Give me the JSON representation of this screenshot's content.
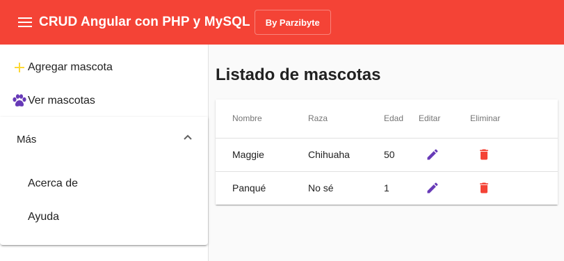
{
  "toolbar": {
    "title": "CRUD Angular con PHP y MySQL",
    "by_label": "By Parzibyte",
    "menu_icon": "menu-icon",
    "color": "#f44336"
  },
  "sidenav": {
    "items": [
      {
        "label": "Agregar mascota",
        "icon": "plus-icon",
        "icon_color": "#fdd835"
      },
      {
        "label": "Ver mascotas",
        "icon": "paw-icon",
        "icon_color": "#673ab7"
      }
    ],
    "panel": {
      "label": "Más",
      "expanded": true,
      "items": [
        {
          "label": "Acerca de"
        },
        {
          "label": "Ayuda"
        }
      ]
    }
  },
  "main": {
    "title": "Listado de mascotas",
    "table": {
      "headers": [
        "Nombre",
        "Raza",
        "Edad",
        "Editar",
        "Eliminar"
      ],
      "rows": [
        {
          "nombre": "Maggie",
          "raza": "Chihuaha",
          "edad": "50"
        },
        {
          "nombre": "Panqué",
          "raza": "No sé",
          "edad": "1"
        }
      ],
      "edit_icon": "pencil-icon",
      "edit_color": "#673ab7",
      "delete_icon": "trash-icon",
      "delete_color": "#f44336"
    }
  }
}
